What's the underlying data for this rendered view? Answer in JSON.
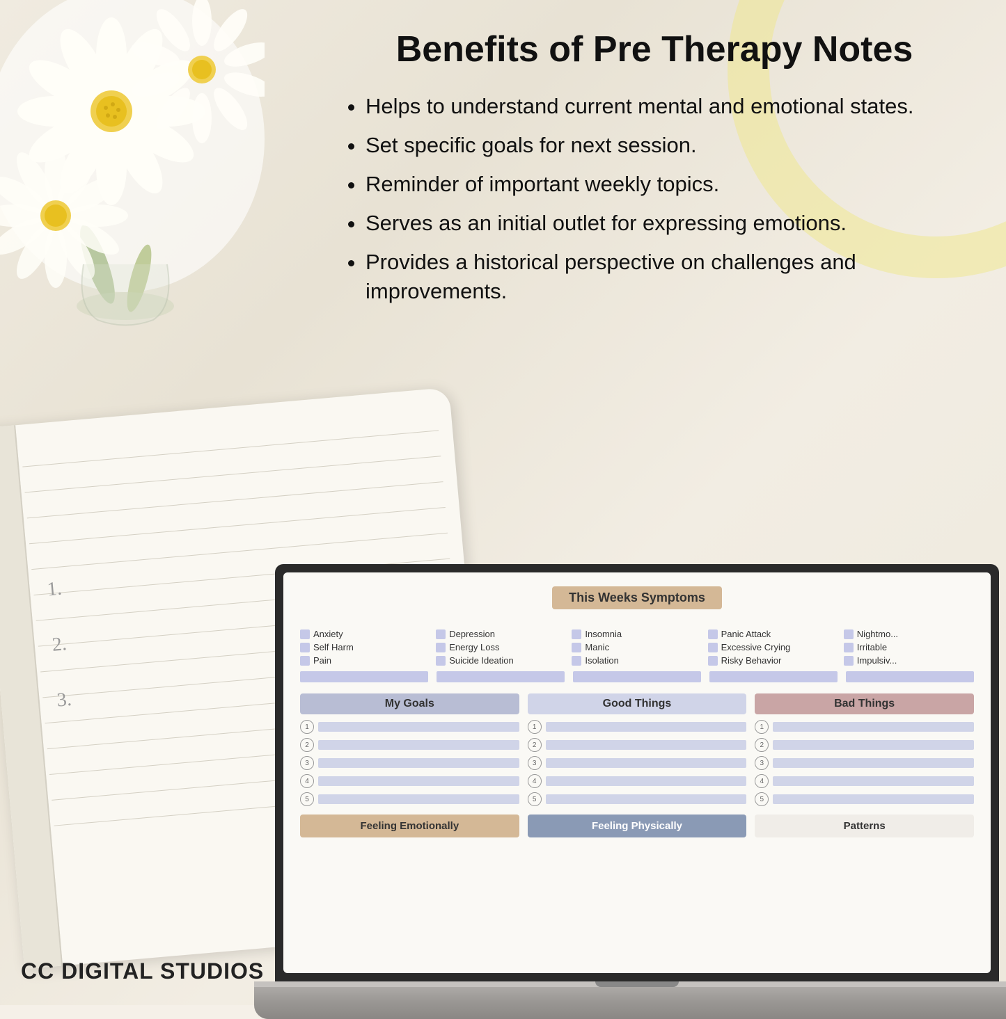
{
  "page": {
    "title": "Benefits of Pre Therapy Notes",
    "benefits": [
      "Helps to understand current mental and emotional states.",
      "Set specific goals for next session.",
      "Reminder of important weekly topics.",
      "Serves as an initial outlet for expressing emotions.",
      "Provides a historical perspective on challenges and improvements."
    ],
    "branding": "CC DIGITAL STUDIOS"
  },
  "screen": {
    "symptoms_header": "This Weeks Symptoms",
    "symptoms": [
      "Anxiety",
      "Depression",
      "Insomnia",
      "Panic Attack",
      "Nightmo...",
      "Self Harm",
      "Energy Loss",
      "Manic",
      "Excessive Crying",
      "Irritable",
      "Pain",
      "Suicide Ideation",
      "Isolation",
      "Risky Behavior",
      "Impulsiv..."
    ],
    "columns": {
      "goals": {
        "header": "My Goals",
        "items": [
          "1",
          "2",
          "3",
          "4",
          "5"
        ]
      },
      "good": {
        "header": "Good Things",
        "items": [
          "1",
          "2",
          "3",
          "4",
          "5"
        ]
      },
      "bad": {
        "header": "Bad Things",
        "items": [
          "1",
          "2",
          "3",
          "4",
          "5"
        ]
      }
    },
    "bottom_sections": {
      "emotional": "Feeling Emotionally",
      "physical": "Feeling Physically",
      "patterns": "Patterns"
    }
  }
}
